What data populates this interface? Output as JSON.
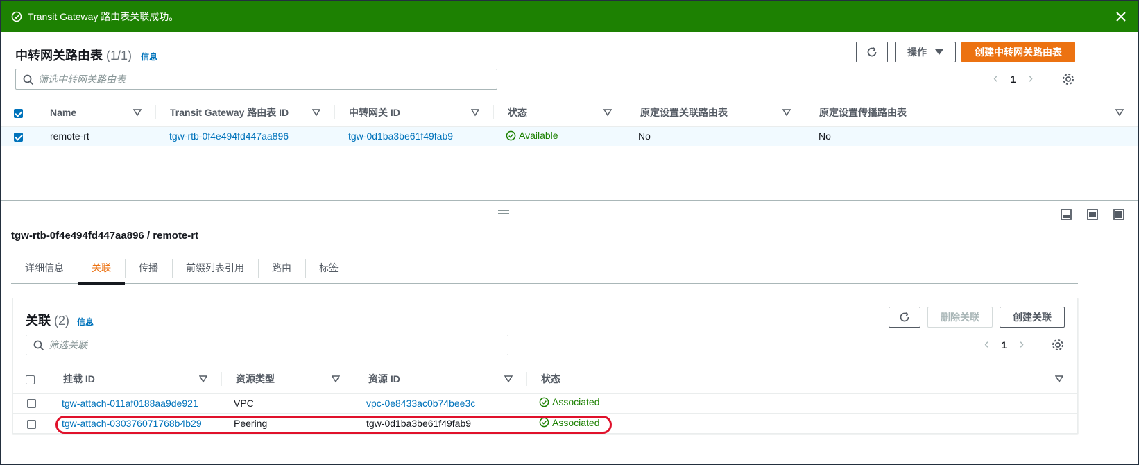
{
  "flash": {
    "message": "Transit Gateway 路由表关联成功。",
    "color": "#1d8102"
  },
  "main": {
    "title": "中转网关路由表",
    "count": "(1/1)",
    "info": "信息",
    "actions_label": "操作",
    "create_label": "创建中转网关路由表",
    "search_placeholder": "筛选中转网关路由表",
    "page": "1",
    "columns": [
      "Name",
      "Transit Gateway 路由表 ID",
      "中转网关 ID",
      "状态",
      "原定设置关联路由表",
      "原定设置传播路由表"
    ],
    "rows": [
      {
        "name": "remote-rt",
        "rtb_id": "tgw-rtb-0f4e494fd447aa896",
        "tgw_id": "tgw-0d1ba3be61f49fab9",
        "status": "Available",
        "default_assoc": "No",
        "default_prop": "No",
        "selected": true
      }
    ]
  },
  "detail": {
    "title": "tgw-rtb-0f4e494fd447aa896 / remote-rt",
    "tabs": [
      "详细信息",
      "关联",
      "传播",
      "前缀列表引用",
      "路由",
      "标签"
    ],
    "active_tab": "关联",
    "assoc": {
      "title": "关联",
      "count": "(2)",
      "info": "信息",
      "delete_label": "删除关联",
      "create_label": "创建关联",
      "search_placeholder": "筛选关联",
      "page": "1",
      "columns": [
        "挂载 ID",
        "资源类型",
        "资源 ID",
        "状态"
      ],
      "rows": [
        {
          "attach_id": "tgw-attach-011af0188aa9de921",
          "type": "VPC",
          "resource_id": "vpc-0e8433ac0b74bee3c",
          "resource_is_link": true,
          "status": "Associated"
        },
        {
          "attach_id": "tgw-attach-030376071768b4b29",
          "type": "Peering",
          "resource_id": "tgw-0d1ba3be61f49fab9",
          "resource_is_link": false,
          "status": "Associated"
        }
      ]
    }
  }
}
